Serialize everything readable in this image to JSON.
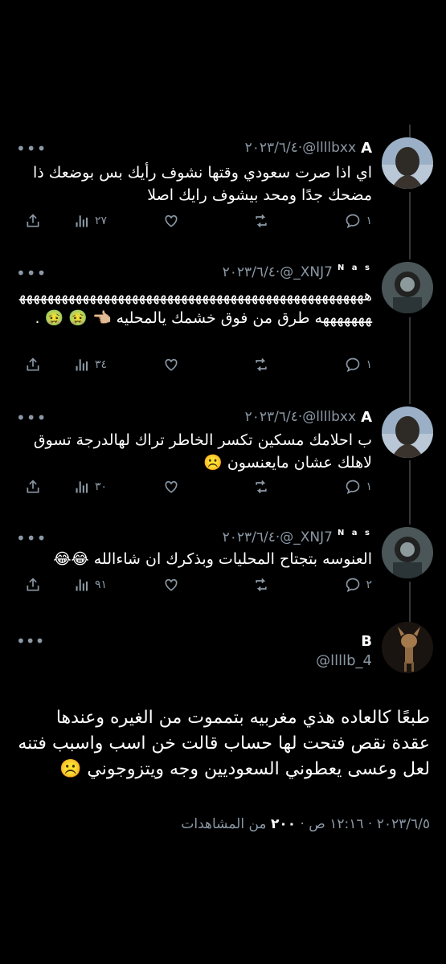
{
  "tweets": [
    {
      "name": "A",
      "sup": "",
      "handle": "@llllbxx",
      "date": "٢٠٢٣/٦/٤",
      "text": "اي اذا صرت سعودي وقتها نشوف رأيك بس بوضعك ذا مضحك جدًا ومحد بيشوف رايك اصلا",
      "replies": "١",
      "views": "٢٧"
    },
    {
      "name": "",
      "sup": "N a s",
      "handle": "@_XNJ7",
      "date": "٢٠٢٣/٦/٤",
      "text": "هههههههههههههههههههههههههههههههههههههههههههههههههههههههههه طرق من فوق خشمك يالمحليه 👈🏼 🤢 🤢 .",
      "replies": "١",
      "views": "٣٤"
    },
    {
      "name": "A",
      "sup": "",
      "handle": "@llllbxx",
      "date": "٢٠٢٣/٦/٤",
      "text": "ب احلامك مسكين تكسر الخاطر تراك لهالدرجة تسوق لاهلك عشان مايعنسون ☹️",
      "replies": "١",
      "views": "٣٠"
    },
    {
      "name": "",
      "sup": "N a s",
      "handle": "@_XNJ7",
      "date": "٢٠٢٣/٦/٤",
      "text": "العنوسه بتجتاح المحليات وبذكرك ان شاءالله 😂😂",
      "replies": "٢",
      "views": "٩١"
    }
  ],
  "main": {
    "name": "B",
    "handle": "@llllb_4",
    "text": "طبعًا كالعاده هذي مغربيه بتمموت من الغيره وعندها عقدة نقص فتحت لها حساب قالت خن اسب واسبب فتنه لعل وعسى يعطوني السعوديين وجه ويتزوجوني ☹️",
    "time": "١٢:١٦ ص",
    "date": "٢٠٢٣/٦/٥",
    "views_count": "٢٠٠",
    "views_label": "من المشاهدات"
  },
  "colors": {
    "background": "#000000",
    "muted": "#8b98a5",
    "text": "#ffffff"
  }
}
